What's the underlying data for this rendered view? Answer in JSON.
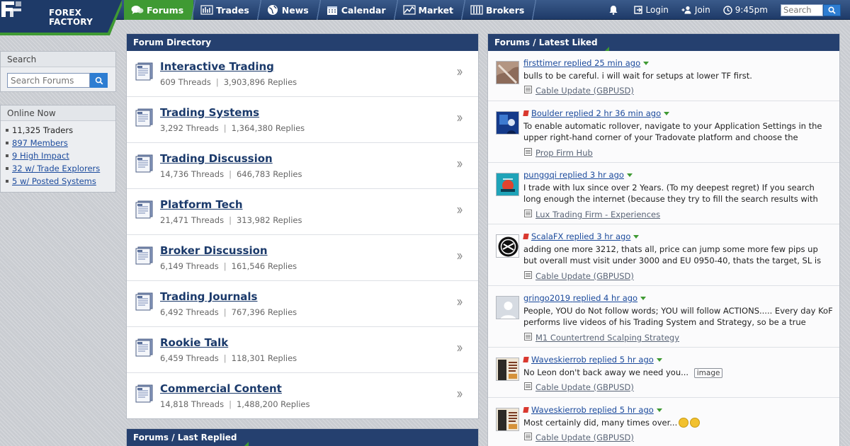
{
  "brand": {
    "line1": "FOREX",
    "line2": "FACTORY"
  },
  "nav": {
    "items": [
      {
        "label": "Forums",
        "icon": "chat-bubbles-icon",
        "active": true
      },
      {
        "label": "Trades",
        "icon": "bar-chart-icon",
        "active": false
      },
      {
        "label": "News",
        "icon": "globe-icon",
        "active": false
      },
      {
        "label": "Calendar",
        "icon": "calendar-icon",
        "active": false
      },
      {
        "label": "Market",
        "icon": "line-chart-icon",
        "active": false
      },
      {
        "label": "Brokers",
        "icon": "columns-icon",
        "active": false
      }
    ],
    "login_label": "Login",
    "join_label": "Join",
    "time": "9:45pm",
    "search_placeholder": "Search"
  },
  "sidebar": {
    "search_title": "Search",
    "search_placeholder": "Search Forums",
    "online_title": "Online Now",
    "online": [
      {
        "text": "11,325 Traders",
        "link": false
      },
      {
        "text": "897 Members",
        "link": true
      },
      {
        "text": "9 High Impact",
        "link": true
      },
      {
        "text": "32 w/ Trade Explorers",
        "link": true
      },
      {
        "text": "5 w/ Posted Systems",
        "link": true
      }
    ]
  },
  "directory": {
    "title": "Forum Directory",
    "forums": [
      {
        "name": "Interactive Trading",
        "threads": "609 Threads",
        "replies": "3,903,896 Replies"
      },
      {
        "name": "Trading Systems",
        "threads": "3,292 Threads",
        "replies": "1,364,380 Replies"
      },
      {
        "name": "Trading Discussion",
        "threads": "14,736 Threads",
        "replies": "646,783 Replies"
      },
      {
        "name": "Platform Tech",
        "threads": "21,471 Threads",
        "replies": "313,982 Replies"
      },
      {
        "name": "Broker Discussion",
        "threads": "6,149 Threads",
        "replies": "161,546 Replies"
      },
      {
        "name": "Trading Journals",
        "threads": "6,492 Threads",
        "replies": "767,396 Replies"
      },
      {
        "name": "Rookie Talk",
        "threads": "6,459 Threads",
        "replies": "118,301 Replies"
      },
      {
        "name": "Commercial Content",
        "threads": "14,818 Threads",
        "replies": "1,488,200 Replies"
      }
    ]
  },
  "last_replied": {
    "title": "Forums / Last Replied"
  },
  "latest_liked": {
    "title": "Forums / Latest Liked",
    "posts": [
      {
        "user": "firsttimer",
        "when": "replied 25 min ago",
        "flag": false,
        "avatar": "photo-brown",
        "text": "bulls to be careful. i will wait for setups at lower TF first.",
        "thread": "Cable Update (GBPUSD)",
        "lines": 1
      },
      {
        "user": "Boulder",
        "when": "replied 2 hr 36 min ago",
        "flag": true,
        "avatar": "photo-blue",
        "text": "To enable automatic rollover, navigate to your Application Settings in the upper right-hand corner of your Tradovate platform and choose the",
        "thread": "Prop Firm Hub",
        "lines": 2
      },
      {
        "user": "punggqi",
        "when": "replied 3 hr ago",
        "flag": false,
        "avatar": "photo-teal",
        "text": "I trade with lux since over 2 Years. (To my deepest regret) If you search long enough the internet (because they try to fill the search results with nonsense",
        "thread": "Lux Trading Firm - Experiences",
        "lines": 2
      },
      {
        "user": "ScalaFX",
        "when": "replied 3 hr ago",
        "flag": true,
        "avatar": "logo-round",
        "text": "adding one more 3212, thats all, price can jump some more few pips up but overall must visit under 3000 and EU 0950-40, thats the target, SL is mental",
        "thread": "Cable Update (GBPUSD)",
        "lines": 2
      },
      {
        "user": "gringo2019",
        "when": "replied 4 hr ago",
        "flag": false,
        "avatar": "placeholder",
        "text": "People, YOU do Not follow words; YOU will follow ACTIONS..... Every day KoF performs live videos of his Trading System and Strategy, so be a true",
        "thread": "M1 Countertrend Scalping Strategy",
        "lines": 2
      },
      {
        "user": "Waveskierrob",
        "when": "replied 5 hr ago",
        "flag": true,
        "avatar": "book-cover",
        "text": "No Leon don't back away we need you...",
        "image_tag": "image",
        "thread": "Cable Update (GBPUSD)",
        "lines": 1
      },
      {
        "user": "Waveskierrob",
        "when": "replied 5 hr ago",
        "flag": true,
        "avatar": "book-cover",
        "text": "Most certainly did, many times over...",
        "emoji_count": 2,
        "thread": "Cable Update (GBPUSD)",
        "lines": 1
      }
    ]
  },
  "colors": {
    "header": "#25406f",
    "active_tab": "#3f9a33",
    "link": "#1b3a6b",
    "search_button": "#2d7dd2"
  }
}
